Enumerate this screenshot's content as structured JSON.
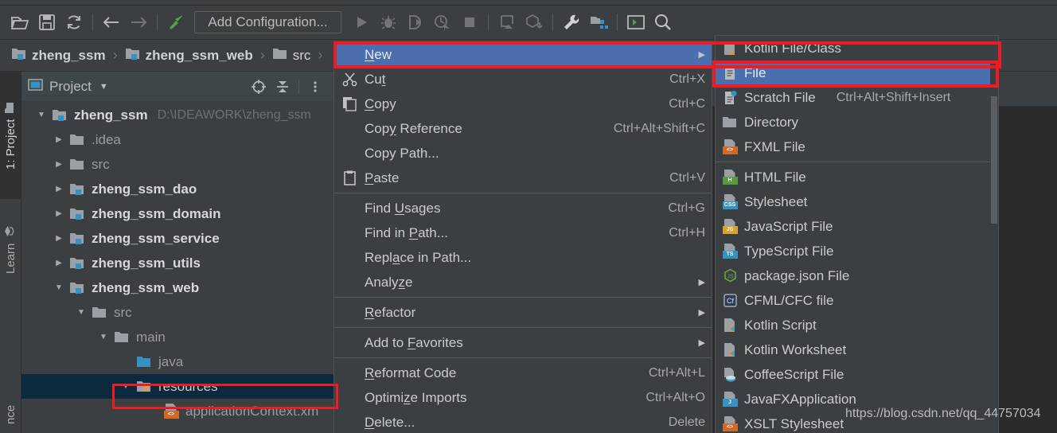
{
  "colors": {
    "panel_bg": "#3c3f41",
    "editor_bg": "#2b2b2b",
    "menu_highlight": "#4b6eaf",
    "tree_selection": "#0d293e",
    "annotation_red": "#ed1c24",
    "text": "#c9cbcd"
  },
  "toolbar": {
    "icons": [
      {
        "name": "open-folder-icon",
        "glyph": "open-folder"
      },
      {
        "name": "save-all-icon",
        "glyph": "save"
      },
      {
        "name": "sync-icon",
        "glyph": "sync"
      },
      {
        "name": "back-arrow-icon",
        "glyph": "arrow-left"
      },
      {
        "name": "forward-arrow-icon",
        "glyph": "arrow-right"
      },
      {
        "name": "build-hammer-icon",
        "glyph": "hammer"
      }
    ],
    "run_config_label": "Add Configuration...",
    "run_icons": [
      {
        "name": "run-icon",
        "glyph": "play"
      },
      {
        "name": "debug-icon",
        "glyph": "bug"
      },
      {
        "name": "run-with-coverage-icon",
        "glyph": "coverage"
      },
      {
        "name": "profile-icon",
        "glyph": "profiler"
      },
      {
        "name": "stop-icon",
        "glyph": "stop"
      },
      {
        "name": "update-app-icon",
        "glyph": "update-app"
      },
      {
        "name": "build-artifact-icon",
        "glyph": "package-down"
      },
      {
        "name": "settings-wrench-icon",
        "glyph": "wrench"
      },
      {
        "name": "project-structure-icon",
        "glyph": "project-structure"
      },
      {
        "name": "terminal-icon",
        "glyph": "terminal"
      },
      {
        "name": "search-everywhere-icon",
        "glyph": "magnifier"
      }
    ]
  },
  "breadcrumb": {
    "items": [
      {
        "label": "zheng_ssm",
        "icon": "module-folder-icon",
        "bold": true
      },
      {
        "label": "zheng_ssm_web",
        "icon": "module-folder-icon",
        "bold": true
      },
      {
        "label": "src",
        "icon": "folder-icon",
        "bold": false
      }
    ],
    "separator": "›"
  },
  "tool_window_tabs": [
    {
      "label": "1: Project",
      "icon": "project-folder-icon",
      "active": true
    },
    {
      "label": "Learn",
      "icon": "learn-icon",
      "active": false
    },
    {
      "label": "nce",
      "icon": "",
      "active": false
    }
  ],
  "project_panel": {
    "title": "Project",
    "dropdown_caret": "▼",
    "actions": [
      {
        "name": "select-opened-file-icon",
        "glyph": "target"
      },
      {
        "name": "collapse-all-icon",
        "glyph": "collapse"
      }
    ],
    "tree": [
      {
        "depth": 0,
        "twisty": "▼",
        "icon": "module-folder-icon",
        "label": "zheng_ssm",
        "bold": true,
        "path": "D:\\IDEAWORK\\zheng_ssm",
        "selected": false
      },
      {
        "depth": 1,
        "twisty": "▶",
        "icon": "folder-icon",
        "label": ".idea",
        "bold": false,
        "path": "",
        "selected": false
      },
      {
        "depth": 1,
        "twisty": "▶",
        "icon": "folder-icon",
        "label": "src",
        "bold": false,
        "path": "",
        "selected": false
      },
      {
        "depth": 1,
        "twisty": "▶",
        "icon": "module-folder-icon",
        "label": "zheng_ssm_dao",
        "bold": true,
        "path": "",
        "selected": false
      },
      {
        "depth": 1,
        "twisty": "▶",
        "icon": "module-folder-icon",
        "label": "zheng_ssm_domain",
        "bold": true,
        "path": "",
        "selected": false
      },
      {
        "depth": 1,
        "twisty": "▶",
        "icon": "module-folder-icon",
        "label": "zheng_ssm_service",
        "bold": true,
        "path": "",
        "selected": false
      },
      {
        "depth": 1,
        "twisty": "▶",
        "icon": "module-folder-icon",
        "label": "zheng_ssm_utils",
        "bold": true,
        "path": "",
        "selected": false
      },
      {
        "depth": 1,
        "twisty": "▼",
        "icon": "module-folder-icon",
        "label": "zheng_ssm_web",
        "bold": true,
        "path": "",
        "selected": false
      },
      {
        "depth": 2,
        "twisty": "▼",
        "icon": "folder-icon",
        "label": "src",
        "bold": false,
        "path": "",
        "selected": false
      },
      {
        "depth": 3,
        "twisty": "▼",
        "icon": "folder-icon",
        "label": "main",
        "bold": false,
        "path": "",
        "selected": false
      },
      {
        "depth": 4,
        "twisty": "",
        "icon": "source-folder-icon",
        "label": "java",
        "bold": false,
        "path": "",
        "selected": false
      },
      {
        "depth": 4,
        "twisty": "▼",
        "icon": "resources-folder-icon",
        "label": "resources",
        "bold": false,
        "path": "",
        "selected": true
      },
      {
        "depth": 5,
        "twisty": "",
        "icon": "xml-file-icon",
        "label": "applicationContext.xm",
        "bold": false,
        "path": "",
        "selected": false
      }
    ]
  },
  "context_menu": {
    "items": [
      {
        "label": "New",
        "icon": "",
        "shortcut": "",
        "submenu": true,
        "selected": true,
        "mnemonic": "N",
        "sep_after": false
      },
      {
        "label": "Cut",
        "icon": "scissors-icon",
        "shortcut": "Ctrl+X",
        "submenu": false,
        "selected": false,
        "mnemonic": "t",
        "sep_after": false
      },
      {
        "label": "Copy",
        "icon": "copy-icon",
        "shortcut": "Ctrl+C",
        "submenu": false,
        "selected": false,
        "mnemonic": "C",
        "sep_after": false
      },
      {
        "label": "Copy Reference",
        "icon": "",
        "shortcut": "Ctrl+Alt+Shift+C",
        "submenu": false,
        "selected": false,
        "mnemonic": "y",
        "sep_after": false
      },
      {
        "label": "Copy Path...",
        "icon": "",
        "shortcut": "",
        "submenu": false,
        "selected": false,
        "mnemonic": "",
        "sep_after": false
      },
      {
        "label": "Paste",
        "icon": "paste-icon",
        "shortcut": "Ctrl+V",
        "submenu": false,
        "selected": false,
        "mnemonic": "P",
        "sep_after": true
      },
      {
        "label": "Find Usages",
        "icon": "",
        "shortcut": "Ctrl+G",
        "submenu": false,
        "selected": false,
        "mnemonic": "U",
        "sep_after": false
      },
      {
        "label": "Find in Path...",
        "icon": "",
        "shortcut": "Ctrl+H",
        "submenu": false,
        "selected": false,
        "mnemonic": "P",
        "sep_after": false
      },
      {
        "label": "Replace in Path...",
        "icon": "",
        "shortcut": "",
        "submenu": false,
        "selected": false,
        "mnemonic": "a",
        "sep_after": false
      },
      {
        "label": "Analyze",
        "icon": "",
        "shortcut": "",
        "submenu": true,
        "selected": false,
        "mnemonic": "z",
        "sep_after": true
      },
      {
        "label": "Refactor",
        "icon": "",
        "shortcut": "",
        "submenu": true,
        "selected": false,
        "mnemonic": "R",
        "sep_after": true
      },
      {
        "label": "Add to Favorites",
        "icon": "",
        "shortcut": "",
        "submenu": true,
        "selected": false,
        "mnemonic": "F",
        "sep_after": true
      },
      {
        "label": "Reformat Code",
        "icon": "",
        "shortcut": "Ctrl+Alt+L",
        "submenu": false,
        "selected": false,
        "mnemonic": "R",
        "sep_after": false
      },
      {
        "label": "Optimize Imports",
        "icon": "",
        "shortcut": "Ctrl+Alt+O",
        "submenu": false,
        "selected": false,
        "mnemonic": "z",
        "sep_after": false
      },
      {
        "label": "Delete...",
        "icon": "",
        "shortcut": "Delete",
        "submenu": false,
        "selected": false,
        "mnemonic": "D",
        "sep_after": false
      }
    ]
  },
  "new_submenu": {
    "items": [
      {
        "label": "Kotlin File/Class",
        "icon": "kotlin-file-icon",
        "shortcut": "",
        "selected": false,
        "sep_after": false
      },
      {
        "label": "File",
        "icon": "file-icon",
        "shortcut": "",
        "selected": true,
        "sep_after": false
      },
      {
        "label": "Scratch File",
        "icon": "scratch-file-icon",
        "shortcut": "Ctrl+Alt+Shift+Insert",
        "selected": false,
        "sep_after": false
      },
      {
        "label": "Directory",
        "icon": "directory-icon",
        "shortcut": "",
        "selected": false,
        "sep_after": false
      },
      {
        "label": "FXML File",
        "icon": "fxml-file-icon",
        "shortcut": "",
        "selected": false,
        "sep_after": true
      },
      {
        "label": "HTML File",
        "icon": "html-file-icon",
        "shortcut": "",
        "selected": false,
        "sep_after": false
      },
      {
        "label": "Stylesheet",
        "icon": "css-file-icon",
        "shortcut": "",
        "selected": false,
        "sep_after": false
      },
      {
        "label": "JavaScript File",
        "icon": "js-file-icon",
        "shortcut": "",
        "selected": false,
        "sep_after": false
      },
      {
        "label": "TypeScript File",
        "icon": "ts-file-icon",
        "shortcut": "",
        "selected": false,
        "sep_after": false
      },
      {
        "label": "package.json File",
        "icon": "nodejs-icon",
        "shortcut": "",
        "selected": false,
        "sep_after": false
      },
      {
        "label": "CFML/CFC file",
        "icon": "cfml-icon",
        "shortcut": "",
        "selected": false,
        "sep_after": false
      },
      {
        "label": "Kotlin Script",
        "icon": "kotlin-script-icon",
        "shortcut": "",
        "selected": false,
        "sep_after": false
      },
      {
        "label": "Kotlin Worksheet",
        "icon": "kotlin-worksheet-icon",
        "shortcut": "",
        "selected": false,
        "sep_after": false
      },
      {
        "label": "CoffeeScript File",
        "icon": "coffeescript-icon",
        "shortcut": "",
        "selected": false,
        "sep_after": false
      },
      {
        "label": "JavaFXApplication",
        "icon": "javafx-icon",
        "shortcut": "",
        "selected": false,
        "sep_after": false
      },
      {
        "label": "XSLT Stylesheet",
        "icon": "xslt-icon",
        "shortcut": "",
        "selected": false,
        "sep_after": false
      }
    ]
  },
  "watermark": "https://blog.csdn.net/qq_44757034"
}
